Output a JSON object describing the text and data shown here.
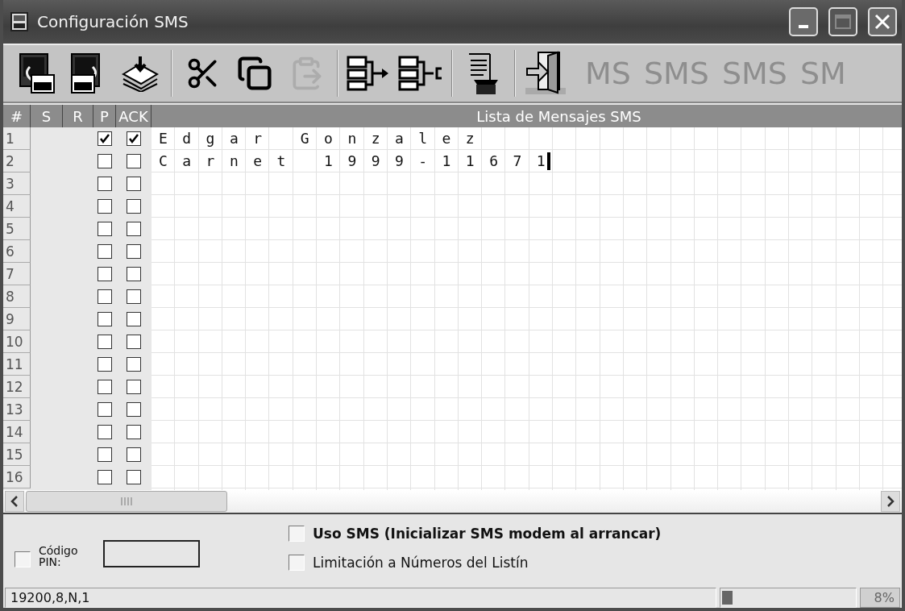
{
  "window": {
    "title": "Configuración SMS",
    "controls": [
      {
        "kind": "minimize",
        "disabled": false
      },
      {
        "kind": "maximize",
        "disabled": true
      },
      {
        "kind": "close",
        "disabled": false
      }
    ]
  },
  "toolbar": {
    "groups": [
      [
        {
          "kind": "receive",
          "disabled": false
        },
        {
          "kind": "send",
          "disabled": false
        },
        {
          "kind": "save",
          "disabled": false
        }
      ],
      [
        {
          "kind": "cut",
          "disabled": false
        },
        {
          "kind": "copy",
          "disabled": false
        },
        {
          "kind": "paste",
          "disabled": true
        }
      ],
      [
        {
          "kind": "insert",
          "disabled": false
        },
        {
          "kind": "remove",
          "disabled": false
        }
      ],
      [
        {
          "kind": "phone",
          "disabled": false
        }
      ],
      [
        {
          "kind": "exit",
          "disabled": false
        }
      ]
    ],
    "background_words": [
      "MS",
      "SMS",
      "SMS",
      "SM"
    ]
  },
  "grid": {
    "columns": [
      "#",
      "S",
      "R",
      "P",
      "ACK"
    ],
    "title": "Lista de Mensajes SMS",
    "rows": [
      {
        "number": "1",
        "p": true,
        "ack": true,
        "message": "Edgar Gonzalez",
        "caret": false
      },
      {
        "number": "2",
        "p": false,
        "ack": false,
        "message": "Carnet 1999-11671",
        "caret": true
      },
      {
        "number": "3",
        "p": false,
        "ack": false,
        "caret": false
      },
      {
        "number": "4",
        "p": false,
        "ack": false,
        "caret": false
      },
      {
        "number": "5",
        "p": false,
        "ack": false,
        "caret": false
      },
      {
        "number": "6",
        "p": false,
        "ack": false,
        "caret": false
      },
      {
        "number": "7",
        "p": false,
        "ack": false,
        "caret": false
      },
      {
        "number": "8",
        "p": false,
        "ack": false,
        "caret": false
      },
      {
        "number": "9",
        "p": false,
        "ack": false,
        "caret": false
      },
      {
        "number": "10",
        "p": false,
        "ack": false,
        "caret": false
      },
      {
        "number": "11",
        "p": false,
        "ack": false,
        "caret": false
      },
      {
        "number": "12",
        "p": false,
        "ack": false,
        "caret": false
      },
      {
        "number": "13",
        "p": false,
        "ack": false,
        "caret": false
      },
      {
        "number": "14",
        "p": false,
        "ack": false,
        "caret": false
      },
      {
        "number": "15",
        "p": false,
        "ack": false,
        "caret": false
      },
      {
        "number": "16",
        "p": false,
        "ack": false,
        "caret": false
      }
    ]
  },
  "options": {
    "use_sms": {
      "label": "Uso SMS (Inicializar SMS modem al arrancar)",
      "checked": false
    },
    "pin": {
      "label": "Código PIN:",
      "checked": false
    },
    "limit": {
      "label": "Limitación a Números del Listín",
      "checked": false
    }
  },
  "status_bar": {
    "port": "19200,8,N,1",
    "progress": {
      "level": 0.08
    },
    "percent": "8%"
  }
}
